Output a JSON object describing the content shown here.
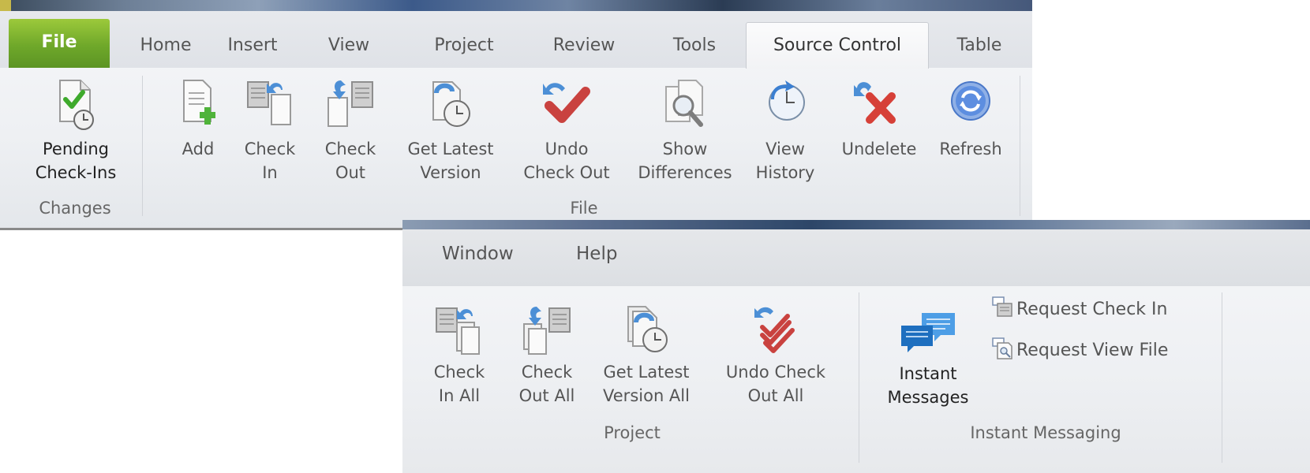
{
  "ribbon_top": {
    "tabs": {
      "file": "File",
      "home": "Home",
      "insert": "Insert",
      "view": "View",
      "project": "Project",
      "review": "Review",
      "tools": "Tools",
      "source_control": "Source Control",
      "table": "Table"
    },
    "changes_group": {
      "label": "Changes",
      "pending_checkins": "Pending\nCheck-Ins"
    },
    "file_group": {
      "label": "File",
      "add": "Add",
      "check_in": "Check\nIn",
      "check_out": "Check\nOut",
      "get_latest": "Get Latest\nVersion",
      "undo_check_out": "Undo\nCheck Out",
      "show_differences": "Show\nDifferences",
      "view_history": "View\nHistory",
      "undelete": "Undelete",
      "refresh": "Refresh"
    }
  },
  "ribbon_bottom": {
    "tabs": {
      "window": "Window",
      "help": "Help"
    },
    "project_group": {
      "label": "Project",
      "check_in_all": "Check\nIn All",
      "check_out_all": "Check\nOut All",
      "get_latest_all": "Get Latest\nVersion All",
      "undo_check_out_all": "Undo Check\nOut All"
    },
    "messaging_group": {
      "label": "Instant Messaging",
      "instant_messages": "Instant\nMessages",
      "request_check_in": "Request Check In",
      "request_view_file": "Request View File"
    }
  },
  "colors": {
    "file_tab": "#7cb22f",
    "check_green": "#3faa2c",
    "undo_red": "#c9423f",
    "history_blue": "#3b7fd1",
    "messages_blue": "#1e6fbf"
  }
}
